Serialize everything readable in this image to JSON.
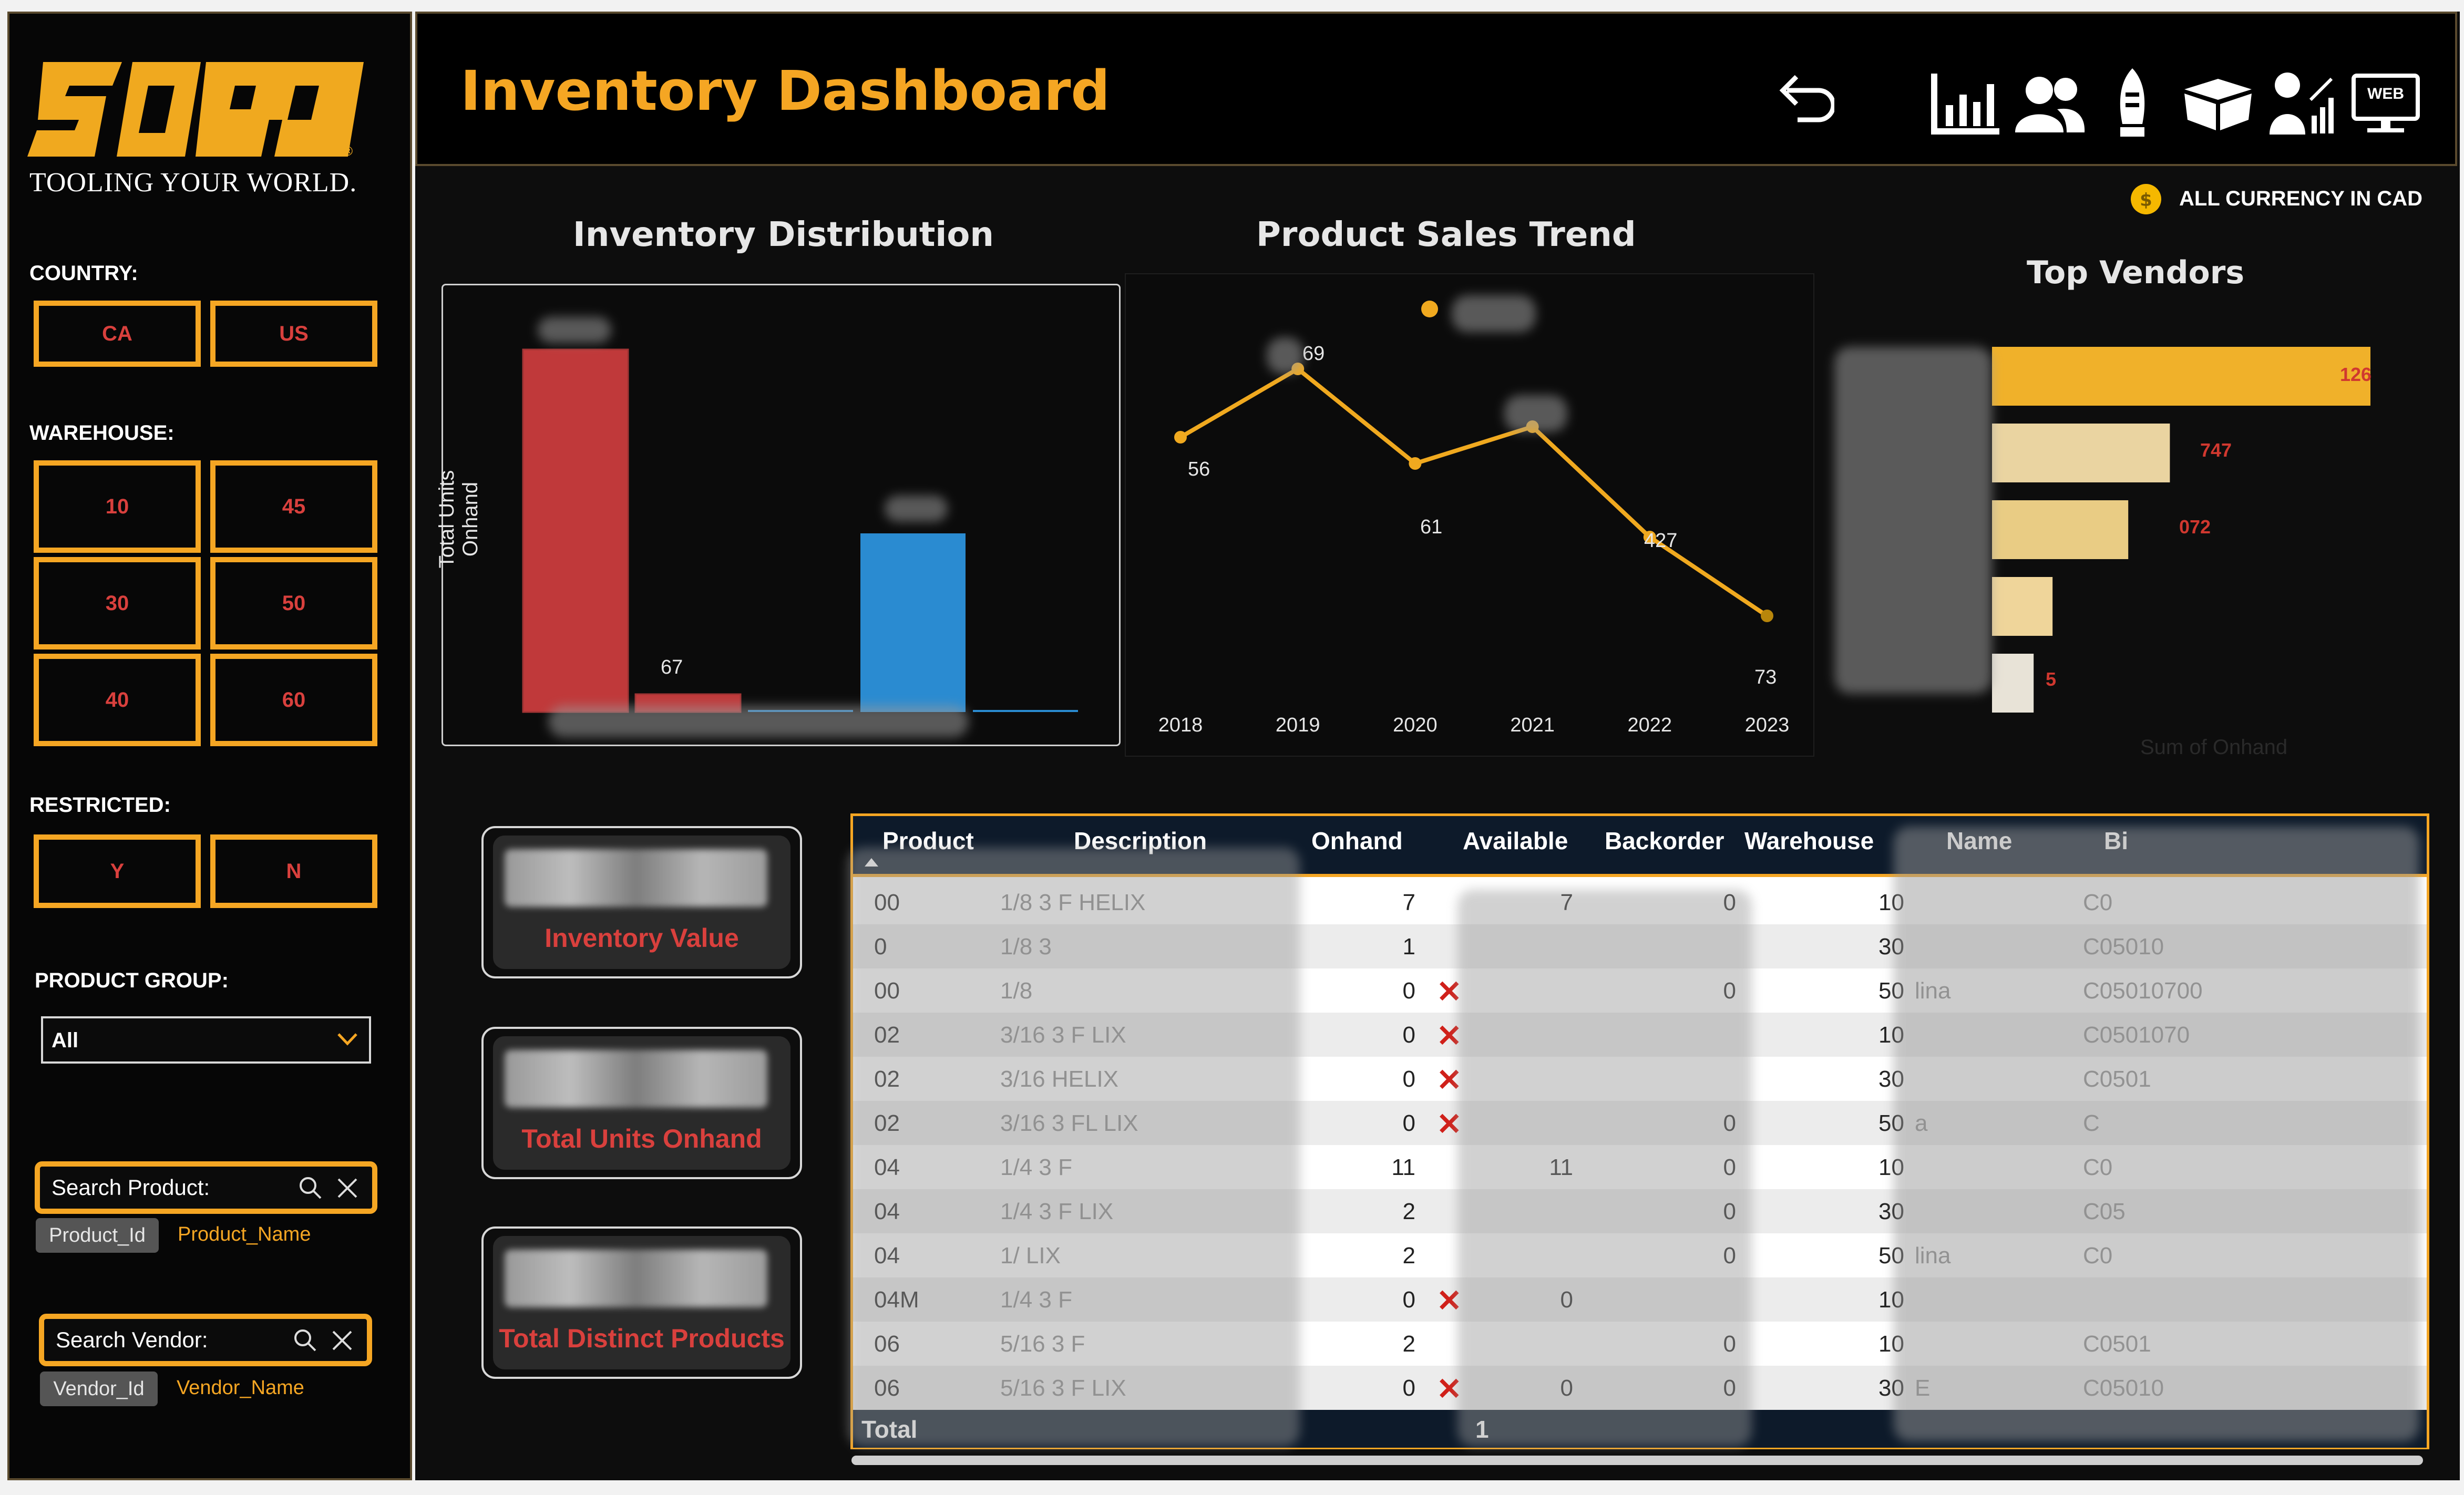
{
  "brand": {
    "logo_text": "SOWA",
    "tagline": "TOOLING YOUR WORLD.",
    "registered_mark": "®"
  },
  "header": {
    "title": "Inventory Dashboard",
    "currency_note": "ALL CURRENCY IN CAD",
    "web_label": "WEB"
  },
  "nav_icons": [
    "undo-icon",
    "bar-chart-icon",
    "users-icon",
    "rocket-icon",
    "box-icon",
    "presenter-icon",
    "web-icon"
  ],
  "filters": {
    "country": {
      "label": "COUNTRY:",
      "options": [
        "CA",
        "US"
      ]
    },
    "warehouse": {
      "label": "WAREHOUSE:",
      "options": [
        "10",
        "45",
        "30",
        "50",
        "40",
        "60"
      ]
    },
    "restricted": {
      "label": "RESTRICTED:",
      "options": [
        "Y",
        "N"
      ]
    },
    "product_group": {
      "label": "PRODUCT GROUP:",
      "value": "All"
    },
    "search_product": {
      "placeholder": "Search Product:",
      "chips": [
        "Product_Id",
        "Product_Name"
      ]
    },
    "search_vendor": {
      "placeholder": "Search Vendor:",
      "chips": [
        "Vendor_Id",
        "Vendor_Name"
      ]
    }
  },
  "charts": {
    "inventory_distribution": {
      "title": "Inventory Distribution",
      "ylabel": "Total Units Onhand",
      "visible_labels": [
        "67"
      ]
    },
    "product_sales_trend": {
      "title": "Product Sales Trend",
      "visible_labels": [
        "69",
        "56",
        "61",
        "427",
        "73"
      ]
    },
    "top_vendors": {
      "title": "Top Vendors",
      "xlabel": "Sum of Onhand",
      "visible_labels": [
        "126",
        "747",
        "072",
        "5"
      ]
    }
  },
  "chart_data": [
    {
      "type": "bar",
      "title": "Inventory Distribution",
      "ylabel": "Total Units Onhand",
      "series": [
        {
          "values": [
            100,
            5,
            0.5,
            0.5,
            49,
            0.5
          ]
        }
      ],
      "colors": [
        "#c0393a",
        "#c0393a",
        "#2a8bd1",
        "#2a8bd1",
        "#2a8bd1",
        "#2a8bd1"
      ]
    },
    {
      "type": "line",
      "title": "Product Sales Trend",
      "x": [
        "2018",
        "2019",
        "2020",
        "2021",
        "2022",
        "2023"
      ],
      "series": [
        {
          "values": [
            56,
            69,
            51,
            58,
            37,
            22
          ]
        }
      ]
    },
    {
      "type": "bar",
      "orientation": "horizontal",
      "title": "Top Vendors",
      "xlabel": "Sum of Onhand",
      "series": [
        {
          "values": [
            100,
            47,
            36,
            16,
            11
          ]
        }
      ],
      "colors": [
        "#f0b12a",
        "#ead4a1",
        "#e9cc84",
        "#efd59a",
        "#e8e3d7"
      ]
    }
  ],
  "kpis": [
    {
      "label": "Inventory Value"
    },
    {
      "label": "Total Units Onhand"
    },
    {
      "label": "Total Distinct Products"
    }
  ],
  "table": {
    "columns": [
      "Product",
      "Description",
      "Onhand",
      "Available",
      "Backorder",
      "Warehouse",
      "Name",
      "Bi"
    ],
    "rows": [
      {
        "product": "00",
        "desc": "1/8 3 F  HELIX",
        "onhand": "7",
        "available": "7",
        "backorder": "0",
        "warehouse": "10",
        "name": "",
        "bin": "C0",
        "x": false
      },
      {
        "product": "0",
        "desc": "1/8 3",
        "onhand": "1",
        "available": "",
        "backorder": "",
        "warehouse": "30",
        "name": "",
        "bin": "C05010",
        "x": false
      },
      {
        "product": "00",
        "desc": "1/8",
        "onhand": "0",
        "available": "",
        "backorder": "0",
        "warehouse": "50",
        "name": "lina",
        "bin": "C05010700",
        "x": true
      },
      {
        "product": "02",
        "desc": "3/16 3 F  LIX",
        "onhand": "0",
        "available": "",
        "backorder": "",
        "warehouse": "10",
        "name": "",
        "bin": "C0501070",
        "x": true
      },
      {
        "product": "02",
        "desc": "3/16  HELIX",
        "onhand": "0",
        "available": "",
        "backorder": "",
        "warehouse": "30",
        "name": "",
        "bin": "C0501",
        "x": true
      },
      {
        "product": "02",
        "desc": "3/16 3 FL  LIX",
        "onhand": "0",
        "available": "",
        "backorder": "0",
        "warehouse": "50",
        "name": "a",
        "bin": "C",
        "x": true
      },
      {
        "product": "04",
        "desc": "1/4 3 F",
        "onhand": "11",
        "available": "11",
        "backorder": "0",
        "warehouse": "10",
        "name": "",
        "bin": "C0",
        "x": false
      },
      {
        "product": "04",
        "desc": "1/4 3 F  LIX",
        "onhand": "2",
        "available": "",
        "backorder": "0",
        "warehouse": "30",
        "name": "",
        "bin": "C05",
        "x": false
      },
      {
        "product": "04",
        "desc": "1/  LIX",
        "onhand": "2",
        "available": "",
        "backorder": "0",
        "warehouse": "50",
        "name": "lina",
        "bin": "C0",
        "x": false
      },
      {
        "product": "04M",
        "desc": "1/4 3 F",
        "onhand": "0",
        "available": "0",
        "backorder": "",
        "warehouse": "10",
        "name": "",
        "bin": "",
        "x": true
      },
      {
        "product": "06",
        "desc": "5/16 3 F",
        "onhand": "2",
        "available": "",
        "backorder": "0",
        "warehouse": "10",
        "name": "",
        "bin": "C0501",
        "x": false
      },
      {
        "product": "06",
        "desc": "5/16 3 F  LIX",
        "onhand": "0",
        "available": "0",
        "backorder": "0",
        "warehouse": "30",
        "name": "E",
        "bin": "C05010",
        "x": true
      }
    ],
    "total_label": "Total",
    "total_values": [
      "1"
    ]
  }
}
